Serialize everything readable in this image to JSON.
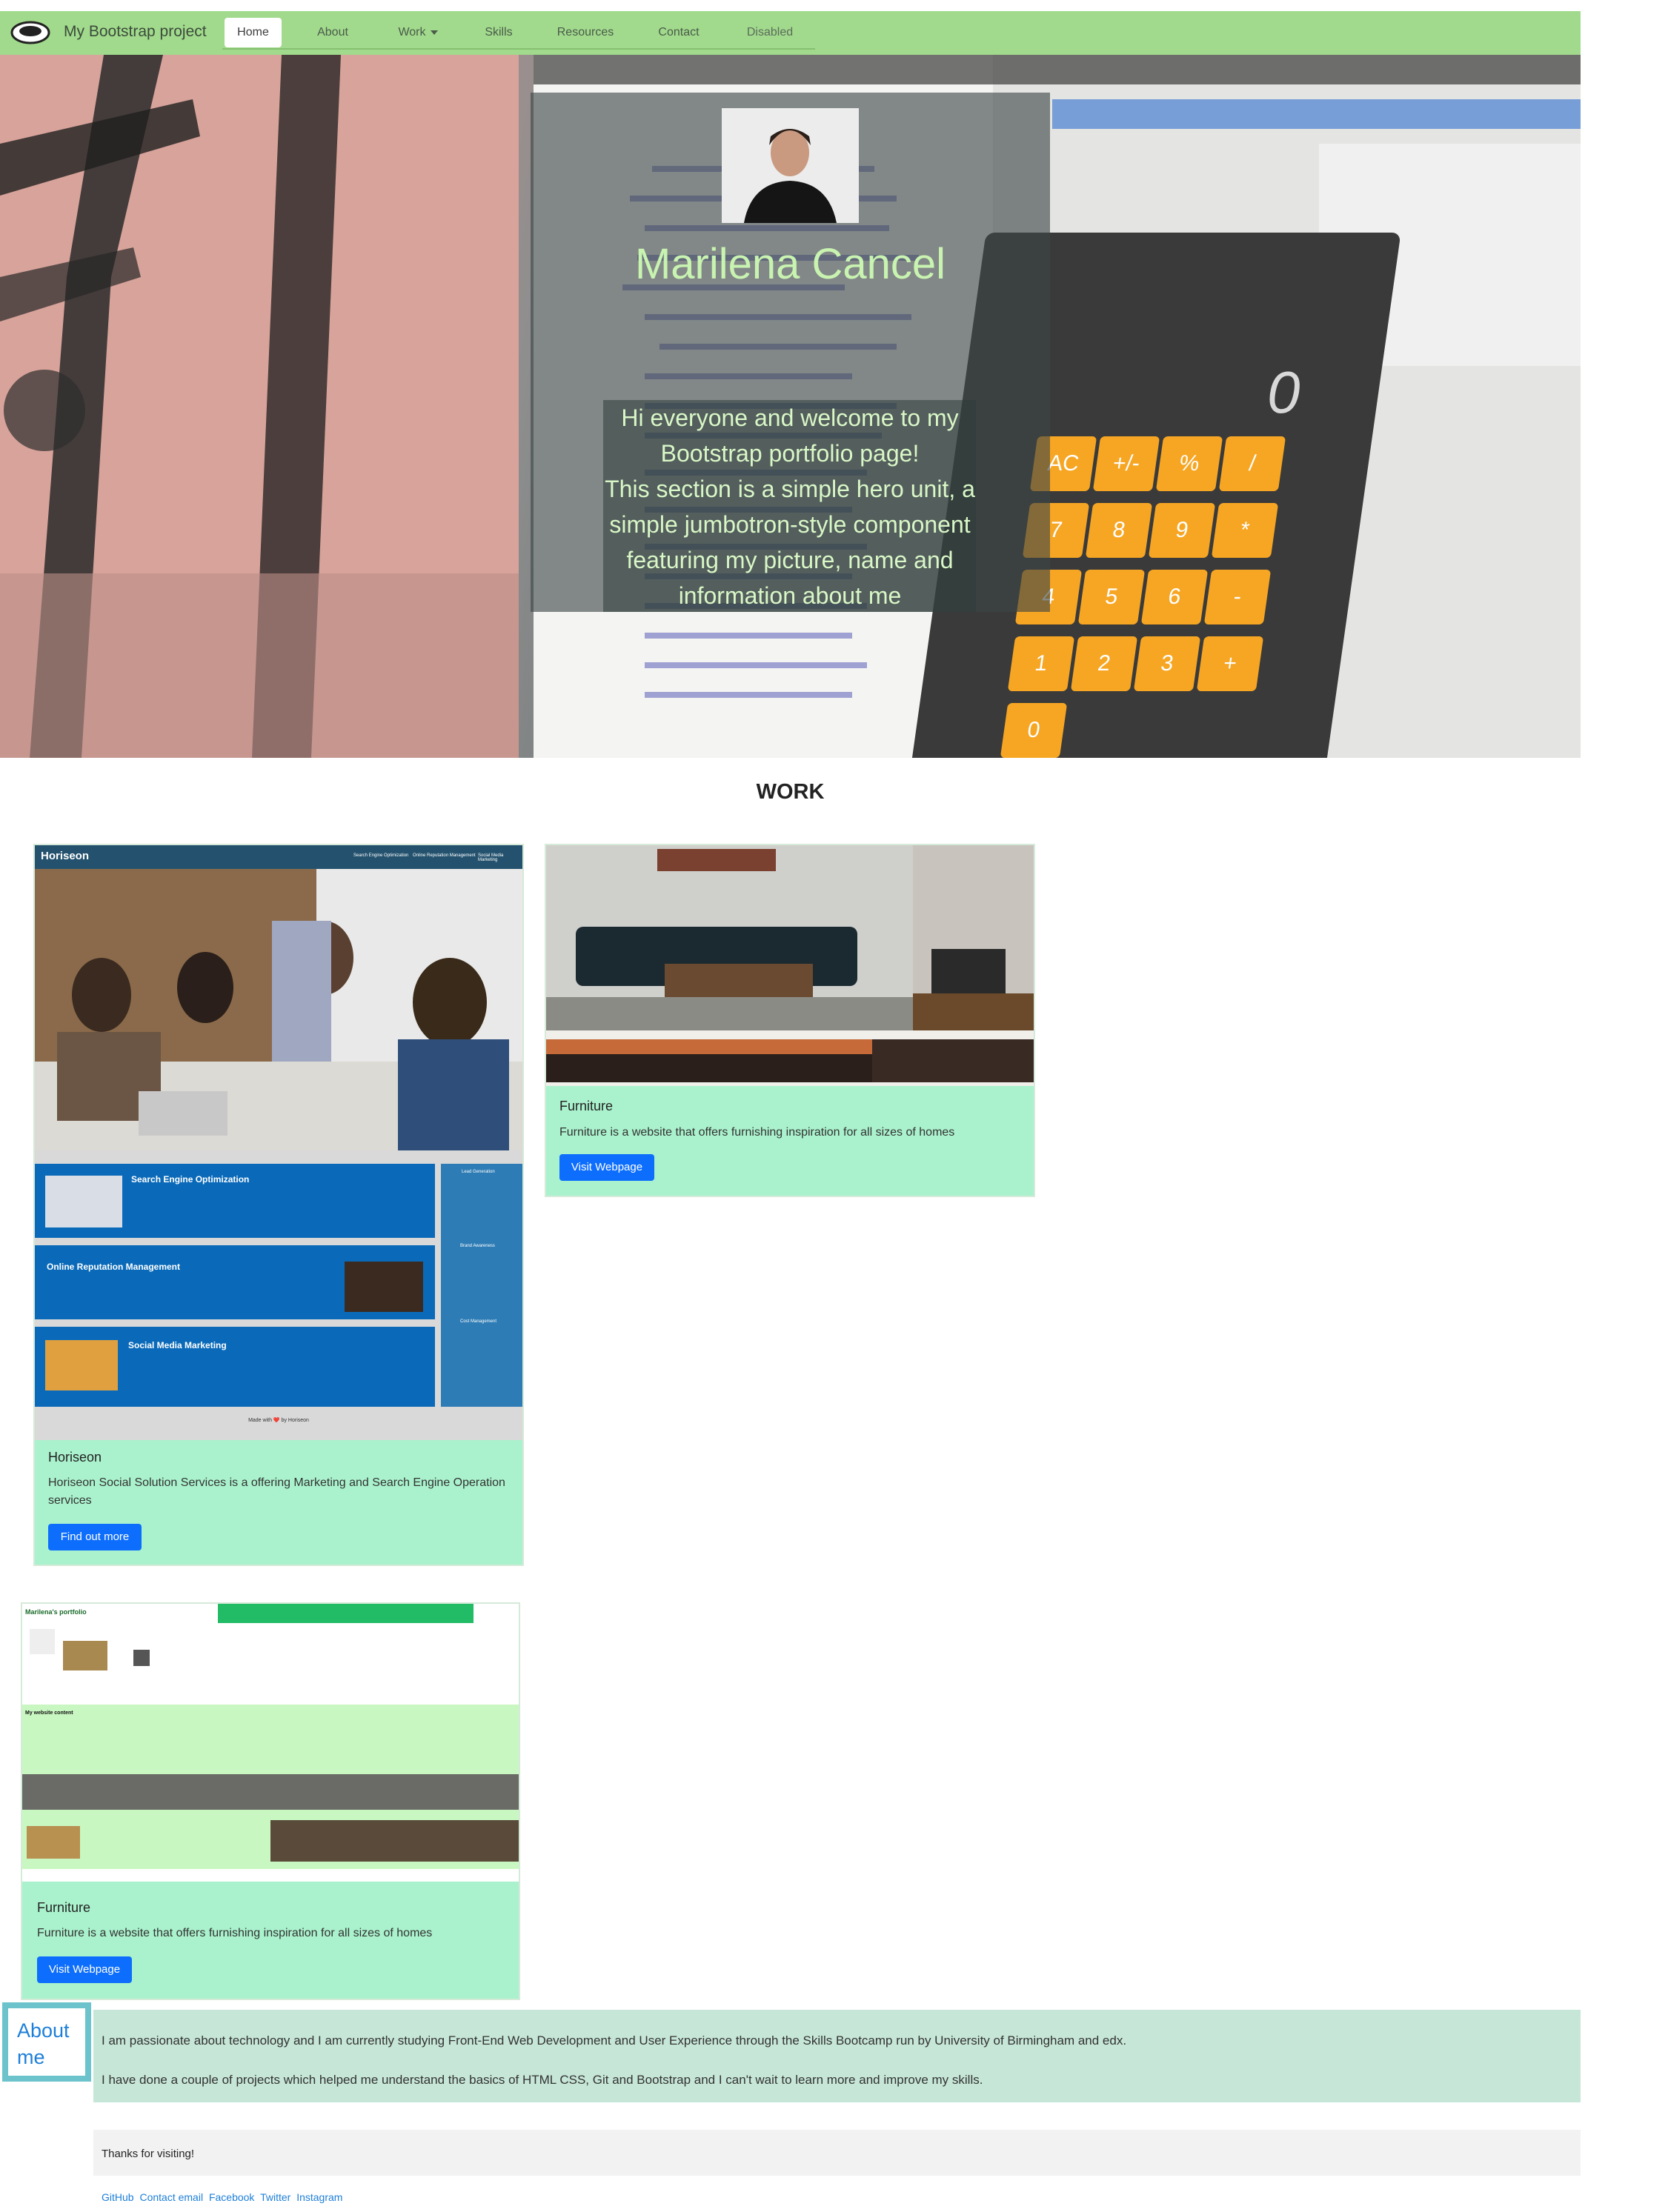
{
  "navbar": {
    "brand": "My Bootstrap project",
    "items": [
      {
        "label": "Home",
        "active": true
      },
      {
        "label": "About"
      },
      {
        "label": "Work",
        "dropdown": true
      },
      {
        "label": "Skills"
      },
      {
        "label": "Resources"
      },
      {
        "label": "Contact"
      },
      {
        "label": "Disabled",
        "disabled": true
      }
    ]
  },
  "hero": {
    "name": "Marilena Cancel",
    "text_lines": [
      "Hi everyone and welcome to my",
      "Bootstrap portfolio page!",
      "This section is a simple hero unit, a",
      "simple jumbotron-style component",
      "featuring my picture, name and",
      "information about me"
    ],
    "calculator_keys": [
      "AC",
      "+/-",
      "%",
      "/",
      "7",
      "8",
      "9",
      "*",
      "4",
      "5",
      "6",
      "-",
      "1",
      "2",
      "3",
      "+",
      "0"
    ],
    "calculator_display": "0"
  },
  "work": {
    "title": "WORK",
    "cards": [
      {
        "title": "Horiseon",
        "text": "Horiseon Social Solution Services is a offering Marketing and Search Engine Operation services",
        "button": "Find out more",
        "screenshot": {
          "brand": "Horiseon",
          "nav": [
            "Search Engine Optimization",
            "Online Reputation Management",
            "Social Media Marketing"
          ],
          "sections": [
            "Search Engine Optimization",
            "Online Reputation Management",
            "Social Media Marketing"
          ],
          "sidebar": [
            "Lead Generation",
            "Brand Awareness",
            "Cost Management"
          ],
          "footer": "Made with ❤️ by Horiseon"
        }
      },
      {
        "title": "Furniture",
        "text": "Furniture is a website that offers furnishing inspiration for all sizes of homes",
        "button": "Visit Webpage"
      },
      {
        "title": "Furniture",
        "text": "Furniture is a website that offers furnishing inspiration for all sizes of homes",
        "button": "Visit Webpage",
        "screenshot": {
          "brand": "Marilena's portfolio",
          "heading": "My website content"
        }
      }
    ]
  },
  "about": {
    "label": "About me",
    "paragraphs": [
      "I am passionate about technology and I am currently studying Front-End Web Development and User Experience through the Skills Bootcamp run by University of Birmingham and edx.",
      "I have done a couple of projects which helped me understand the basics of HTML CSS, Git and Bootstrap and I can't wait to learn more and improve my skills."
    ]
  },
  "footer": {
    "text": "Thanks for visiting!",
    "links": [
      "GitHub",
      "Contact email",
      "Facebook",
      "Twitter",
      "Instagram"
    ]
  },
  "colors": {
    "navbar": "#a1da8c",
    "card": "#aaf2cd",
    "button": "#0d6efd",
    "about_band": "#c6e6d7",
    "about_border": "#6cc3cc",
    "hero_text": "#d9f7c6"
  }
}
